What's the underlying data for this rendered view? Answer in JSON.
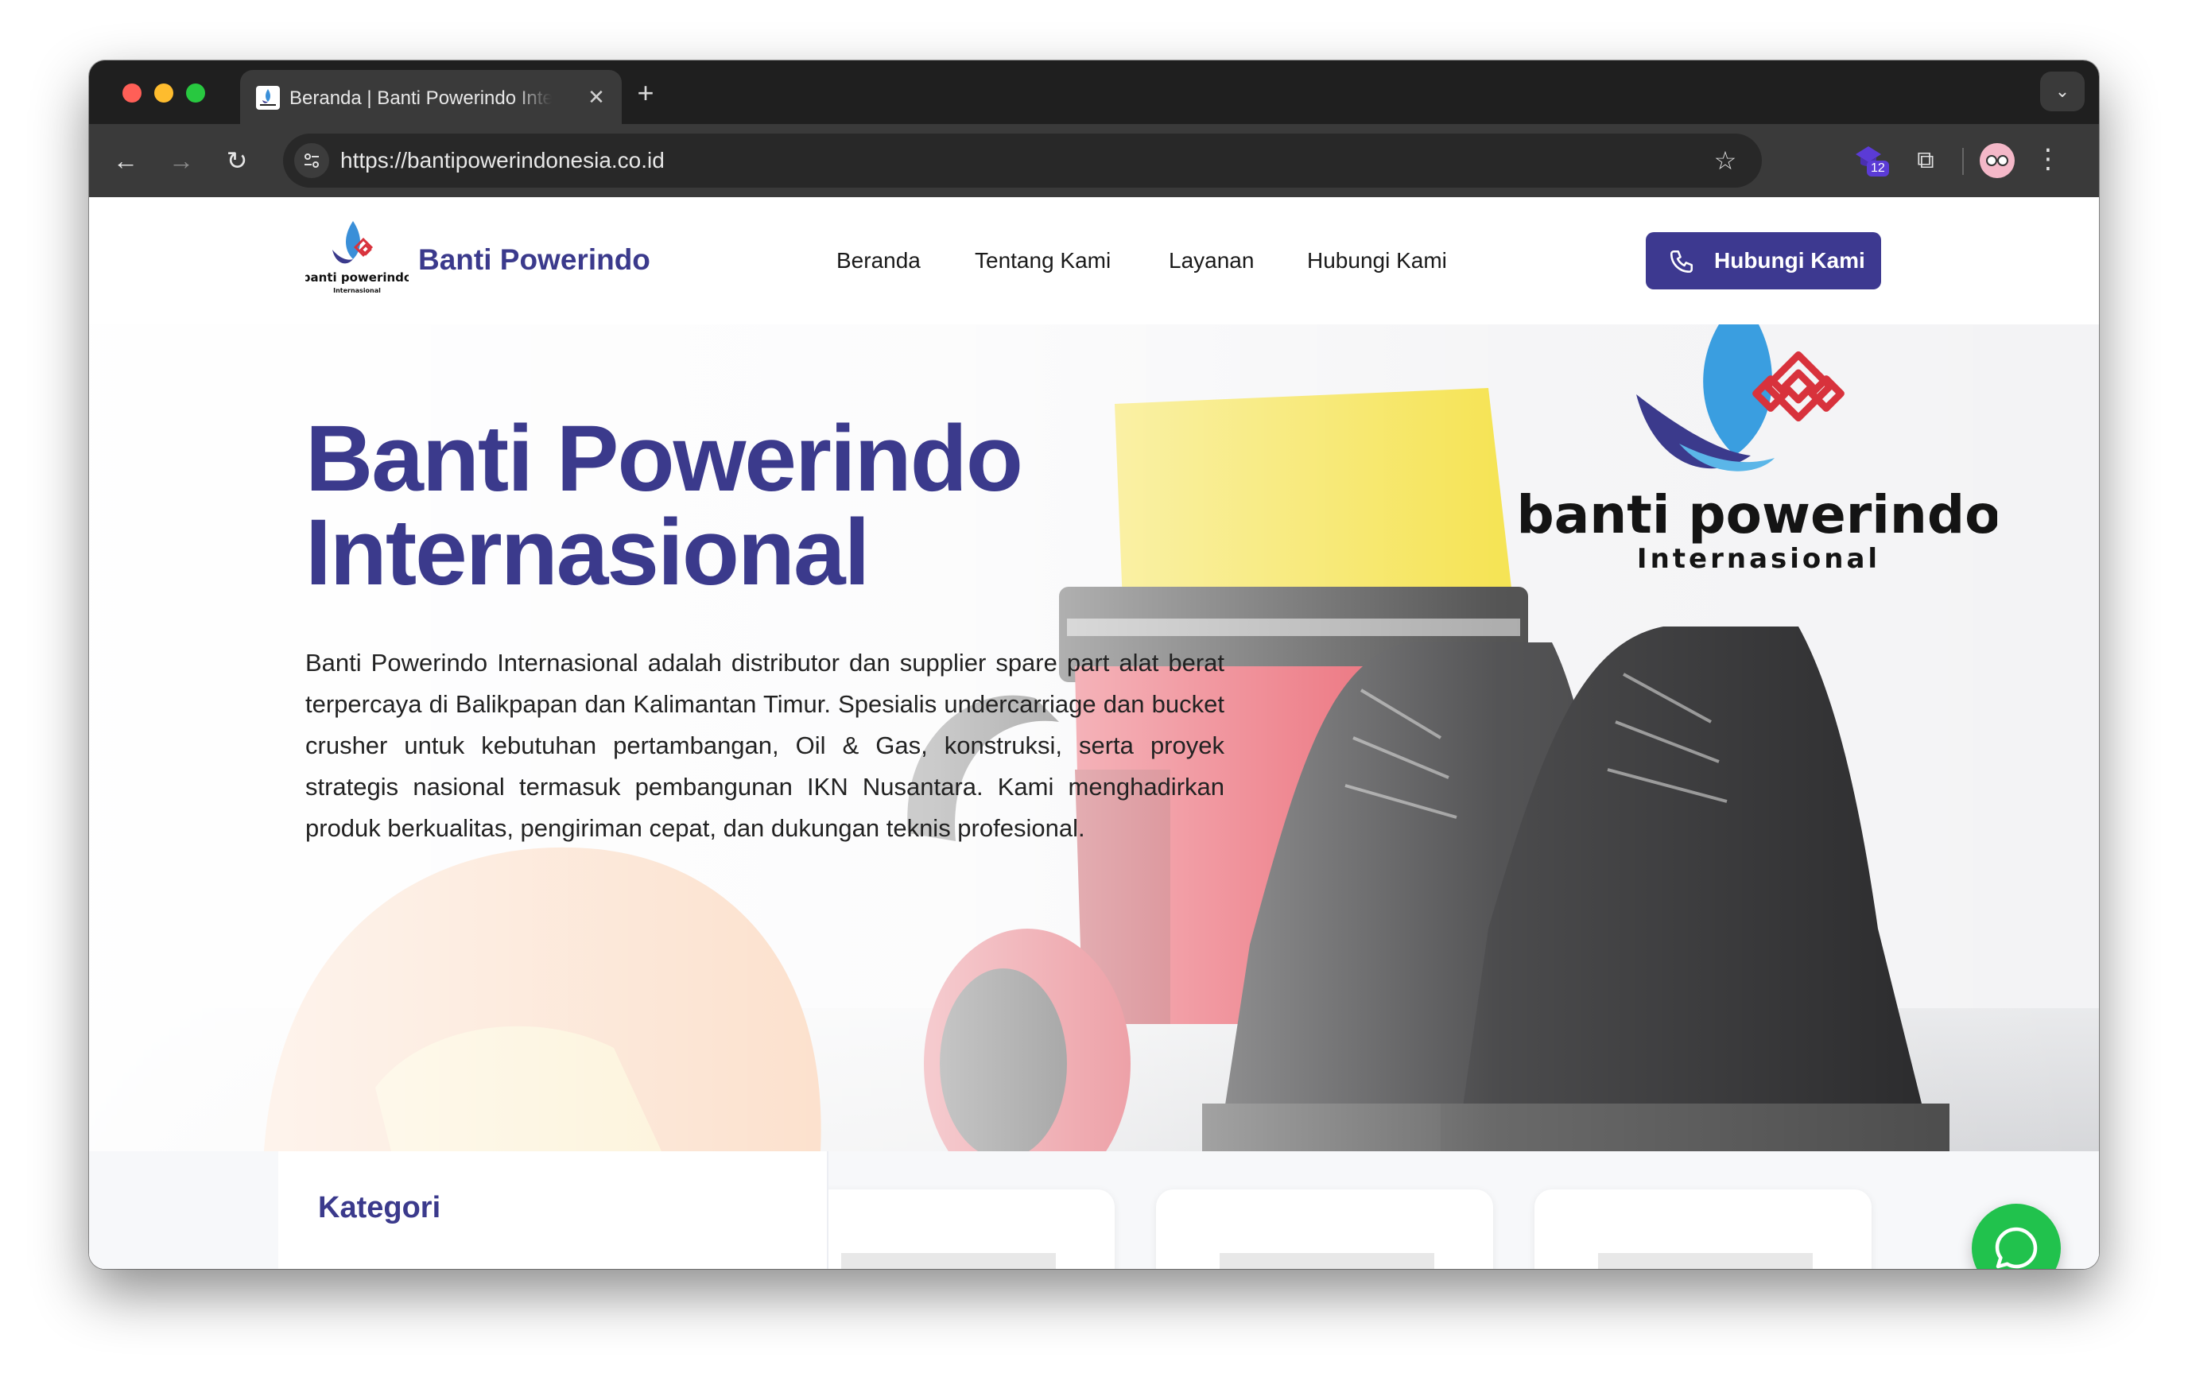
{
  "browser": {
    "tab_title": "Beranda | Banti Powerindo Internasional",
    "tab_close": "✕",
    "new_tab": "+",
    "url": "https://bantipowerindonesia.co.id",
    "extension_badge": "12"
  },
  "site": {
    "brand": "Banti Powerindo",
    "logo_text_main": "banti powerindo",
    "logo_text_sub": "Internasional",
    "nav": [
      {
        "label": "Beranda"
      },
      {
        "label": "Tentang Kami"
      },
      {
        "label": "Layanan"
      },
      {
        "label": "Hubungi Kami"
      }
    ],
    "cta_label": "Hubungi Kami"
  },
  "hero": {
    "title_line1": "Banti Powerindo",
    "title_line2": "Internasional",
    "description": "Banti Powerindo Internasional adalah distributor dan supplier spare part alat berat terpercaya di Balikpapan dan Kalimantan Timur. Spesialis undercarriage dan bucket crusher untuk kebutuhan pertambangan, Oil & Gas, konstruksi, serta proyek strategis nasional termasuk pembangunan IKN Nusantara. Kami menghadirkan produk berkualitas, pengiriman cepat, dan dukungan teknis profesional."
  },
  "sidebar": {
    "title": "Kategori"
  },
  "colors": {
    "brand": "#3b3a8c",
    "cta": "#3d3990",
    "whatsapp": "#21c24d"
  }
}
